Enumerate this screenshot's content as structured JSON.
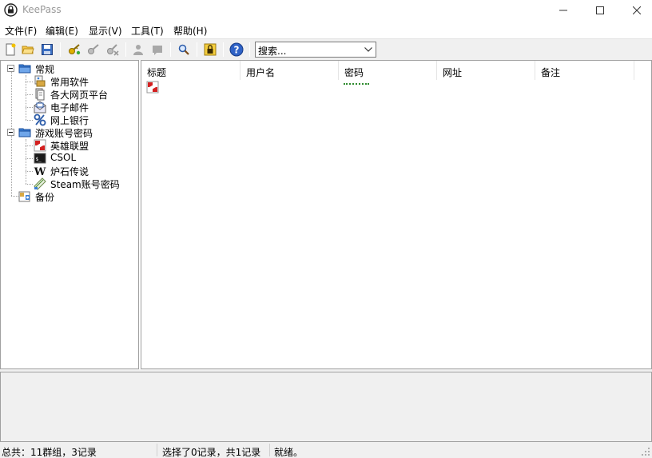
{
  "window": {
    "title": "KeePass"
  },
  "menu": {
    "items": [
      "文件(F)",
      "编辑(E)",
      "显示(V)",
      "工具(T)",
      "帮助(H)"
    ]
  },
  "toolbar": {
    "search_value": "搜索..."
  },
  "tree": {
    "groups": [
      {
        "label": "常规",
        "children": [
          "常用软件",
          "各大网页平台",
          "电子邮件",
          "网上银行"
        ]
      },
      {
        "label": "游戏账号密码",
        "children": [
          "英雄联盟",
          "CSOL",
          "炉石传说",
          "Steam账号密码"
        ]
      },
      {
        "label": "备份",
        "children": []
      }
    ]
  },
  "entries": {
    "columns": [
      "标题",
      "用户名",
      "密码",
      "网址",
      "备注"
    ],
    "rows": [
      {
        "title": "",
        "username": "",
        "password": "********",
        "url": "",
        "notes": ""
      }
    ]
  },
  "status": {
    "summary": "总共：11群组，3记录",
    "selection": "选择了0记录，共1记录",
    "state": "就绪。"
  },
  "icons": {
    "app": "keepass-lock-icon",
    "accent": "#316ac5"
  }
}
